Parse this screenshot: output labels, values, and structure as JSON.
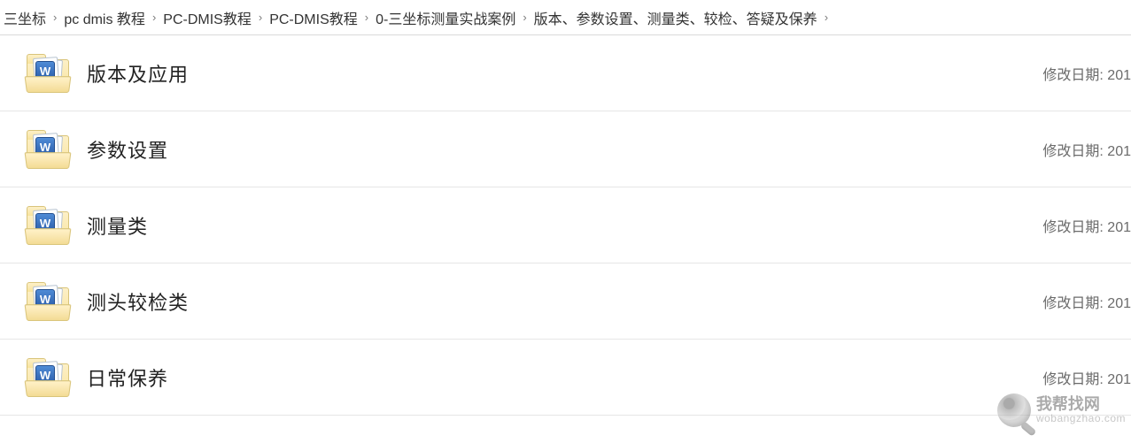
{
  "breadcrumb": {
    "items": [
      {
        "label": "三坐标"
      },
      {
        "label": "pc dmis 教程"
      },
      {
        "label": "PC-DMIS教程"
      },
      {
        "label": "PC-DMIS教程"
      },
      {
        "label": "0-三坐标测量实战案例"
      },
      {
        "label": "版本、参数设置、测量类、较检、答疑及保养"
      }
    ]
  },
  "list": {
    "meta_label": "修改日期: ",
    "doc_badge": "W",
    "items": [
      {
        "name": "版本及应用",
        "modified": "201"
      },
      {
        "name": "参数设置",
        "modified": "201"
      },
      {
        "name": "测量类",
        "modified": "201"
      },
      {
        "name": "测头较检类",
        "modified": "201"
      },
      {
        "name": "日常保养",
        "modified": "201"
      }
    ]
  },
  "watermark": {
    "title": "我帮找网",
    "url": "wobangzhao.com"
  }
}
